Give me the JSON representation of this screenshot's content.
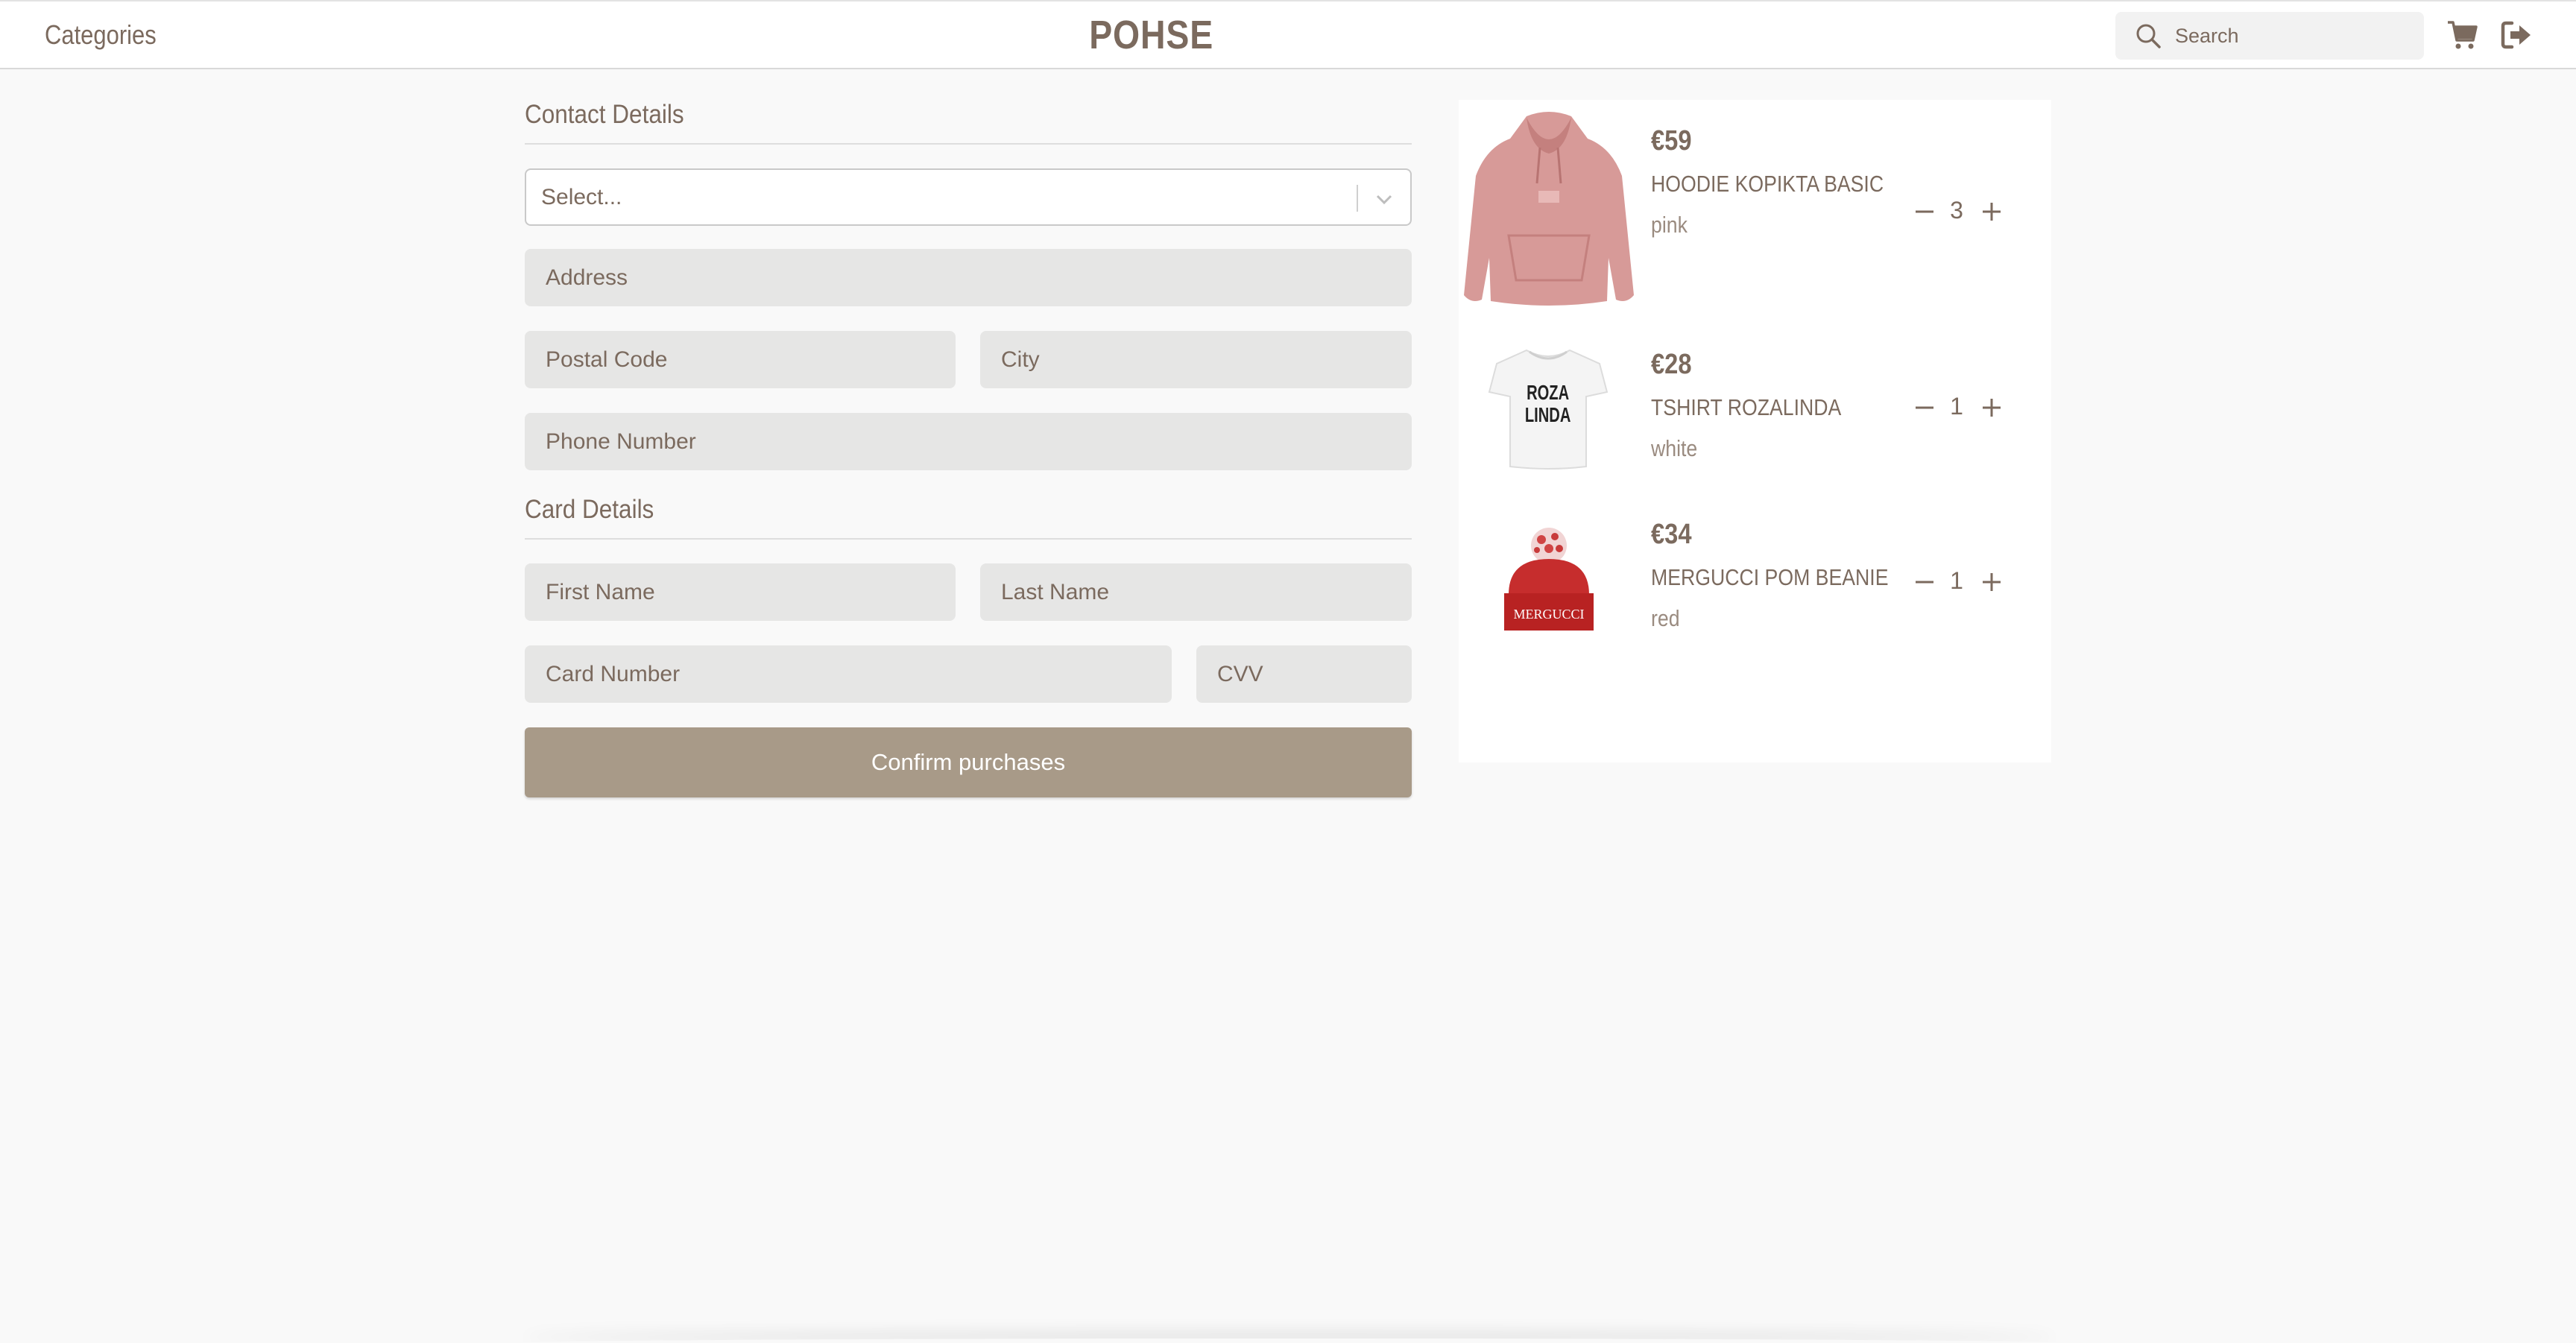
{
  "header": {
    "categories_label": "Categories",
    "brand": "POHSE",
    "search_placeholder": "Search",
    "icons": [
      "search-icon",
      "cart-icon",
      "logout-icon"
    ]
  },
  "contact": {
    "title": "Contact Details",
    "select_placeholder": "Select...",
    "address_placeholder": "Address",
    "postal_placeholder": "Postal Code",
    "city_placeholder": "City",
    "phone_placeholder": "Phone Number"
  },
  "card": {
    "title": "Card Details",
    "first_name_placeholder": "First Name",
    "last_name_placeholder": "Last Name",
    "card_number_placeholder": "Card Number",
    "cvv_placeholder": "CVV"
  },
  "confirm_label": "Confirm purchases",
  "cart_items": [
    {
      "price": "€59",
      "name": "HOODIE KOPIKTA BASIC",
      "color": "pink",
      "qty": "3"
    },
    {
      "price": "€28",
      "name": "TSHIRT ROZALINDA",
      "color": "white",
      "qty": "1",
      "print": [
        "ROZA",
        "LINDA"
      ]
    },
    {
      "price": "€34",
      "name": "MERGUCCI POM BEANIE",
      "color": "red",
      "qty": "1",
      "print": "MERGUCCI"
    }
  ],
  "colors": {
    "text": "#7b6a5e",
    "button": "#a89a88",
    "field": "#e6e6e5"
  }
}
